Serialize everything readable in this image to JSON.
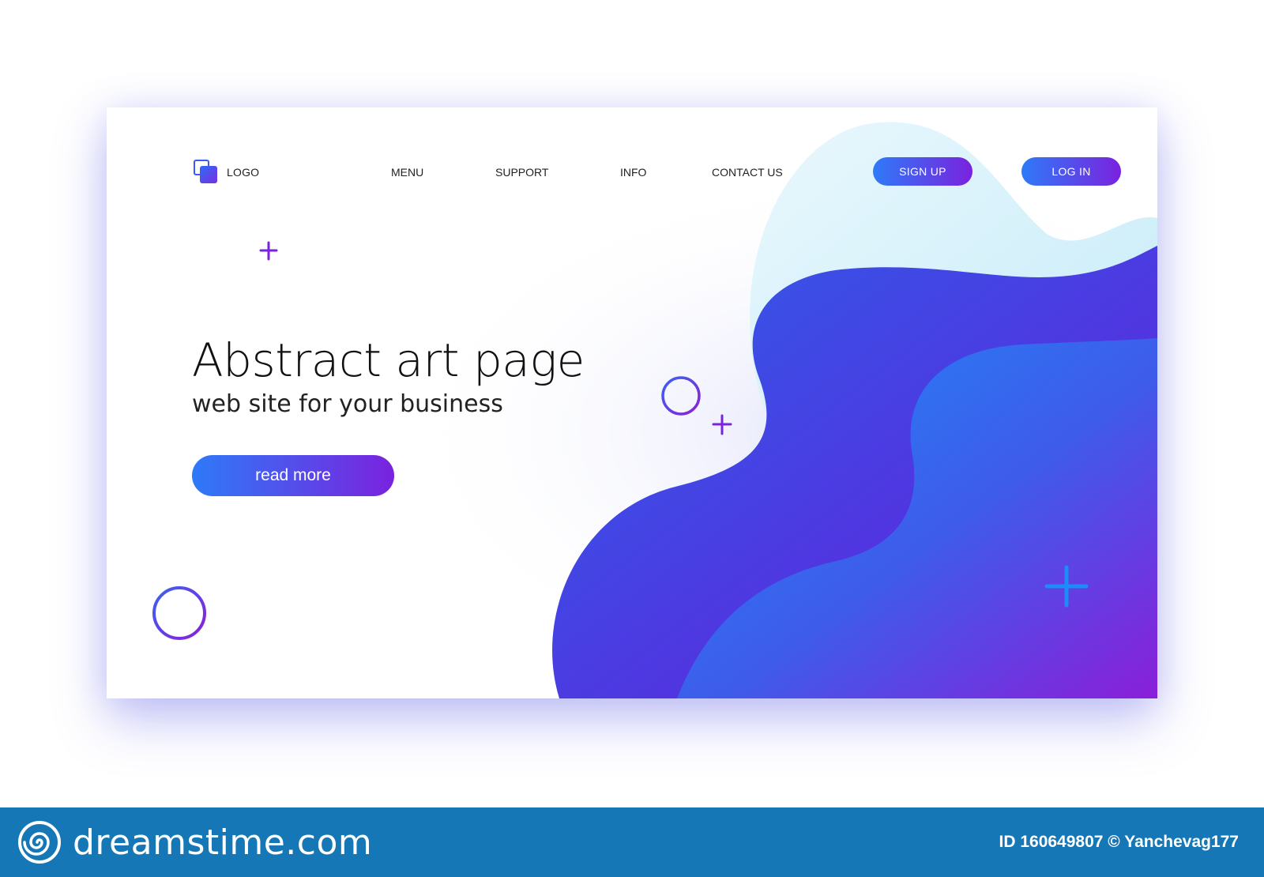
{
  "nav": {
    "logo_label": "LOGO",
    "links": [
      "MENU",
      "SUPPORT",
      "INFO",
      "CONTACT US"
    ],
    "signup_label": "SIGN UP",
    "login_label": "LOG IN"
  },
  "hero": {
    "title": "Abstract art page",
    "subtitle": "web site for your business",
    "cta_label": "read more"
  },
  "footer": {
    "brand": "dreamstime.com",
    "image_id": "ID 160649807",
    "author": "© Yanchevag177"
  },
  "colors": {
    "accent_blue": "#2e7af8",
    "accent_purple": "#7a22de",
    "wave_light": "#d6f1fb",
    "footer_bg": "#1677b6"
  },
  "icons": [
    "logo-squares-icon",
    "plus-icon",
    "ring-icon",
    "spiral-icon"
  ]
}
